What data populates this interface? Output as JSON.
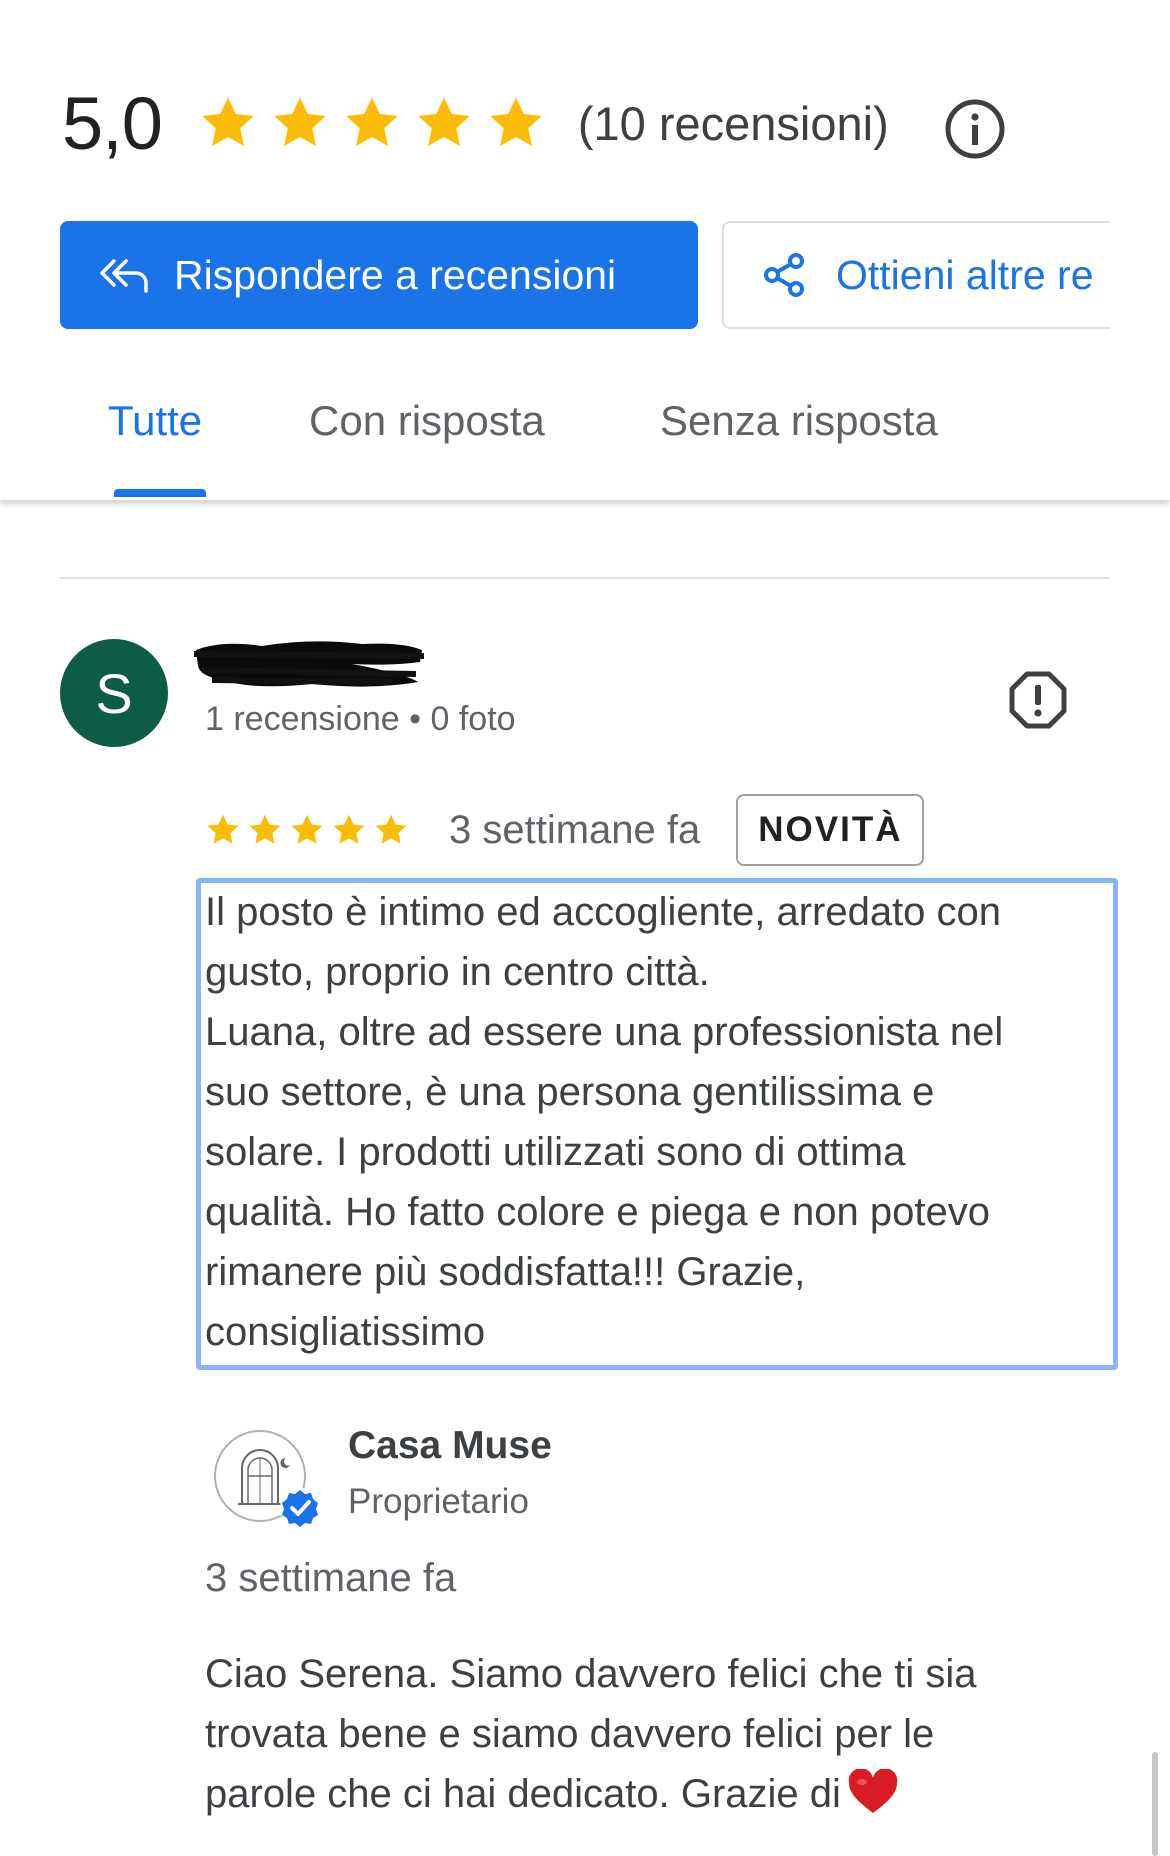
{
  "summary": {
    "rating": "5,0",
    "star_count": 5,
    "reviews_count_label": "(10 recensioni)",
    "info_icon": "info-icon"
  },
  "actions": {
    "reply_label": "Rispondere a recensioni",
    "reply_icon": "reply-all-icon",
    "get_more_label": "Ottieni altre re",
    "share_icon": "share-icon"
  },
  "tabs": [
    {
      "label": "Tutte",
      "active": true
    },
    {
      "label": "Con risposta",
      "active": false
    },
    {
      "label": "Senza risposta",
      "active": false
    }
  ],
  "review": {
    "avatar_letter": "S",
    "avatar_color": "#0d5c46",
    "reviewer_meta": "1 recensione • 0 foto",
    "stars": 5,
    "time": "3 settimane fa",
    "badge": "NOVITÀ",
    "text_lines": [
      "Il posto è intimo ed accogliente, arredato con",
      "gusto, proprio in centro città.",
      "Luana, oltre ad essere una professionista nel",
      "suo settore, è una persona gentilissima e",
      "solare. I prodotti utilizzati sono di ottima",
      "qualità. Ho fatto colore e piega e non potevo",
      "rimanere più soddisfatta!!! Grazie,",
      "consigliatissimo"
    ]
  },
  "owner_reply": {
    "name": "Casa Muse",
    "role": "Proprietario",
    "time": "3 settimane fa",
    "text_lines": [
      "Ciao Serena. Siamo davvero felici che ti sia",
      "trovata bene e siamo davvero felici per le",
      "parole che ci hai dedicato. Grazie di"
    ],
    "emoji": "heart-icon"
  },
  "colors": {
    "accent": "#1a73e8",
    "star": "#fbbc04",
    "highlight_border": "#8ab4f8",
    "heart": "#d81b24"
  }
}
